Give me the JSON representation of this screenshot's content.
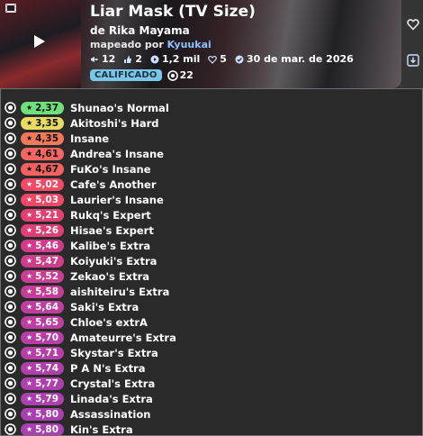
{
  "beatmap": {
    "title": "Liar Mask (TV Size)",
    "artist": "de Rika Mayama",
    "mapped_by_prefix": "mapeado por",
    "mapper": "Kyuukai",
    "stats": {
      "play_count": "12",
      "favourites": "2",
      "plays": "1,2 mil",
      "likes": "5",
      "ranked_date": "30 de mar. de 2026"
    },
    "status": "CALIFICADO",
    "difficulty_count": "22"
  },
  "icons": {
    "cover": "film-icon",
    "play": "play-icon",
    "favourite": "heart-icon",
    "download": "download-icon",
    "mode": "osu-mode-icon"
  },
  "colors": {
    "mapper_link": "#8fc1ff",
    "badge": "#77c7e6"
  },
  "difficulties": [
    {
      "stars": "2,37",
      "name": "Shunao's Normal",
      "color": "#6fe17c",
      "text": "#111"
    },
    {
      "stars": "3,35",
      "name": "Akitoshi's Hard",
      "color": "#e8dd62",
      "text": "#111"
    },
    {
      "stars": "4,35",
      "name": "Insane",
      "color": "#f2785a",
      "text": "#111"
    },
    {
      "stars": "4,61",
      "name": "Andrea's Insane",
      "color": "#f36760",
      "text": "#111"
    },
    {
      "stars": "4,67",
      "name": "FuKo's Insane",
      "color": "#f2605f",
      "text": "#111"
    },
    {
      "stars": "5,02",
      "name": "Cafe's Another",
      "color": "#f04a66",
      "text": "#fff"
    },
    {
      "stars": "5,03",
      "name": "Laurier's Insane",
      "color": "#ef4866",
      "text": "#fff"
    },
    {
      "stars": "5,21",
      "name": "Rukq's Expert",
      "color": "#e43f72",
      "text": "#fff"
    },
    {
      "stars": "5,26",
      "name": "Hisae's Expert",
      "color": "#e03e77",
      "text": "#fff"
    },
    {
      "stars": "5,46",
      "name": "Kalibe's Extra",
      "color": "#d03c8a",
      "text": "#fff"
    },
    {
      "stars": "5,47",
      "name": "Koiyuki's Extra",
      "color": "#cf3c8b",
      "text": "#fff"
    },
    {
      "stars": "5,52",
      "name": "Zekao's Extra",
      "color": "#c93d92",
      "text": "#fff"
    },
    {
      "stars": "5,58",
      "name": "aishiteiru's Extra",
      "color": "#c43e98",
      "text": "#fff"
    },
    {
      "stars": "5,64",
      "name": "Saki's Extra",
      "color": "#bd3e9f",
      "text": "#fff"
    },
    {
      "stars": "5,65",
      "name": "Chloe's extrA",
      "color": "#bc3ea0",
      "text": "#fff"
    },
    {
      "stars": "5,70",
      "name": "Amateurre's Extra",
      "color": "#b63fa5",
      "text": "#fff"
    },
    {
      "stars": "5,71",
      "name": "Skystar's Extra",
      "color": "#b53fa6",
      "text": "#fff"
    },
    {
      "stars": "5,74",
      "name": "P A N's Extra",
      "color": "#b13fa9",
      "text": "#fff"
    },
    {
      "stars": "5,77",
      "name": "Crystal's Extra",
      "color": "#ae40ac",
      "text": "#fff"
    },
    {
      "stars": "5,79",
      "name": "Linada's Extra",
      "color": "#ab40ae",
      "text": "#fff"
    },
    {
      "stars": "5,80",
      "name": "Assassination",
      "color": "#aa40af",
      "text": "#fff"
    },
    {
      "stars": "5,80",
      "name": "Kin's Extra",
      "color": "#aa40af",
      "text": "#fff"
    }
  ]
}
